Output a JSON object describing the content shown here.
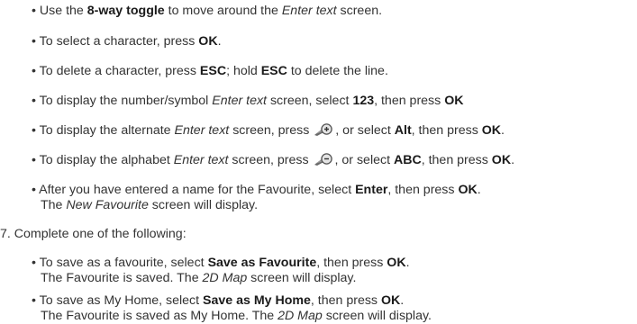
{
  "items": [
    {
      "a": "Use the ",
      "b": "8-way toggle",
      "c": " to move around the ",
      "d": "Enter text",
      "e": " screen."
    },
    {
      "a": "To select a character, press ",
      "b": "OK",
      "c": "."
    },
    {
      "a": "To delete a character, press ",
      "b": "ESC",
      "c": "; hold ",
      "d": "ESC",
      "e": " to delete the line."
    },
    {
      "a": "To display the number/symbol ",
      "b": "Enter text",
      "c": " screen, select ",
      "d": "123",
      "e": ", then press ",
      "f": "OK"
    },
    {
      "a": "To display the alternate ",
      "b": "Enter text",
      "c": " screen, press ",
      "d": ", or select ",
      "e": "Alt",
      "f": ", then press ",
      "g": "OK",
      "h": "."
    },
    {
      "a": "To display the alphabet ",
      "b": "Enter text",
      "c": " screen, press ",
      "d": ", or select ",
      "e": "ABC",
      "f": ", then press ",
      "g": "OK",
      "h": "."
    },
    {
      "a": "After you have entered a name for the Favourite, select ",
      "b": "Enter",
      "c": ", then press ",
      "d": "OK",
      "e": ".",
      "l2a": "The ",
      "l2b": "New Favourite",
      "l2c": " screen will display."
    }
  ],
  "step7": "7. Complete one of the following:",
  "options": [
    {
      "a": "To save as a favourite, select ",
      "b": "Save as Favourite",
      "c": ", then press ",
      "d": "OK",
      "e": ".",
      "l2a": "The Favourite is saved. The ",
      "l2b": "2D Map",
      "l2c": " screen will display."
    },
    {
      "a": "To save as My Home, select ",
      "b": "Save as My Home",
      "c": ", then press ",
      "d": "OK",
      "e": ".",
      "l2a": "The Favourite is saved as My Home. The ",
      "l2b": "2D Map",
      "l2c": " screen will display."
    }
  ],
  "bullet": "•",
  "icons": {
    "zoom_in": "zoom-in-icon",
    "zoom_out": "zoom-out-icon"
  }
}
